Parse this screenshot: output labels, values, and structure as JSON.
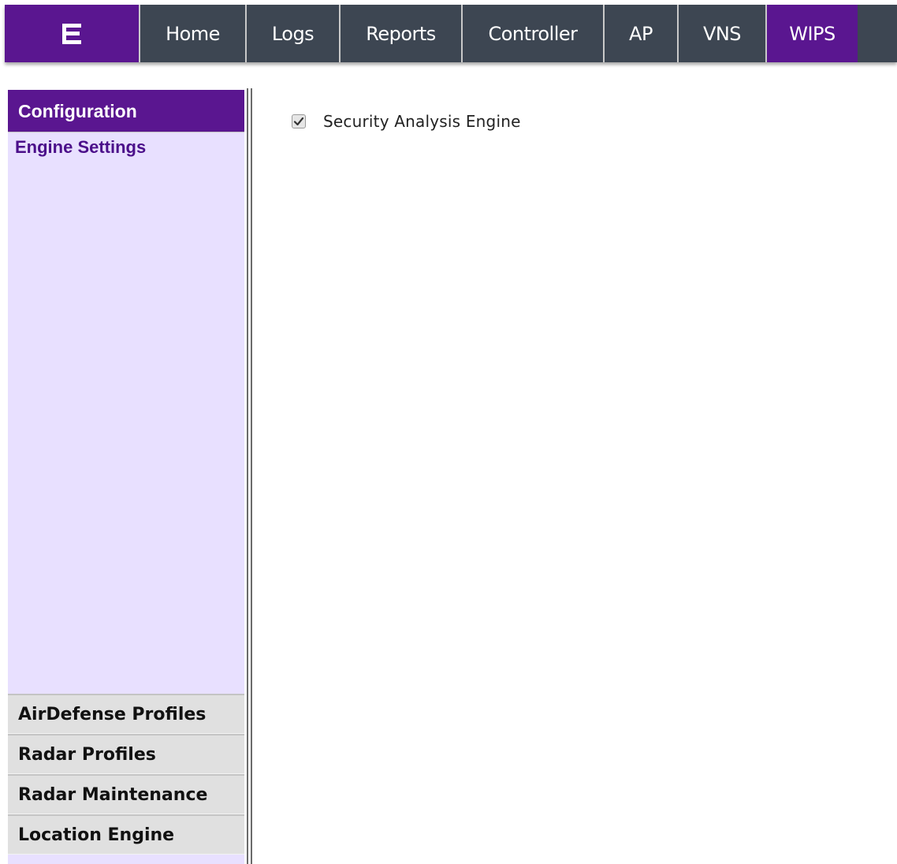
{
  "brand": {
    "logo_icon": "extreme-logo-icon",
    "accent_color": "#5a1690"
  },
  "nav": {
    "tabs": [
      {
        "label": "Home"
      },
      {
        "label": "Logs"
      },
      {
        "label": "Reports"
      },
      {
        "label": "Controller"
      },
      {
        "label": "AP"
      },
      {
        "label": "VNS"
      },
      {
        "label": "WIPS",
        "active": true
      }
    ]
  },
  "sidebar": {
    "active_section": {
      "title": "Configuration",
      "items": [
        {
          "label": "Engine Settings"
        }
      ]
    },
    "collapsed_sections": [
      {
        "title": "AirDefense Profiles"
      },
      {
        "title": "Radar Profiles"
      },
      {
        "title": "Radar Maintenance"
      },
      {
        "title": "Location Engine"
      }
    ]
  },
  "main": {
    "security_analysis_engine": {
      "label": "Security Analysis Engine",
      "checked": true
    }
  }
}
